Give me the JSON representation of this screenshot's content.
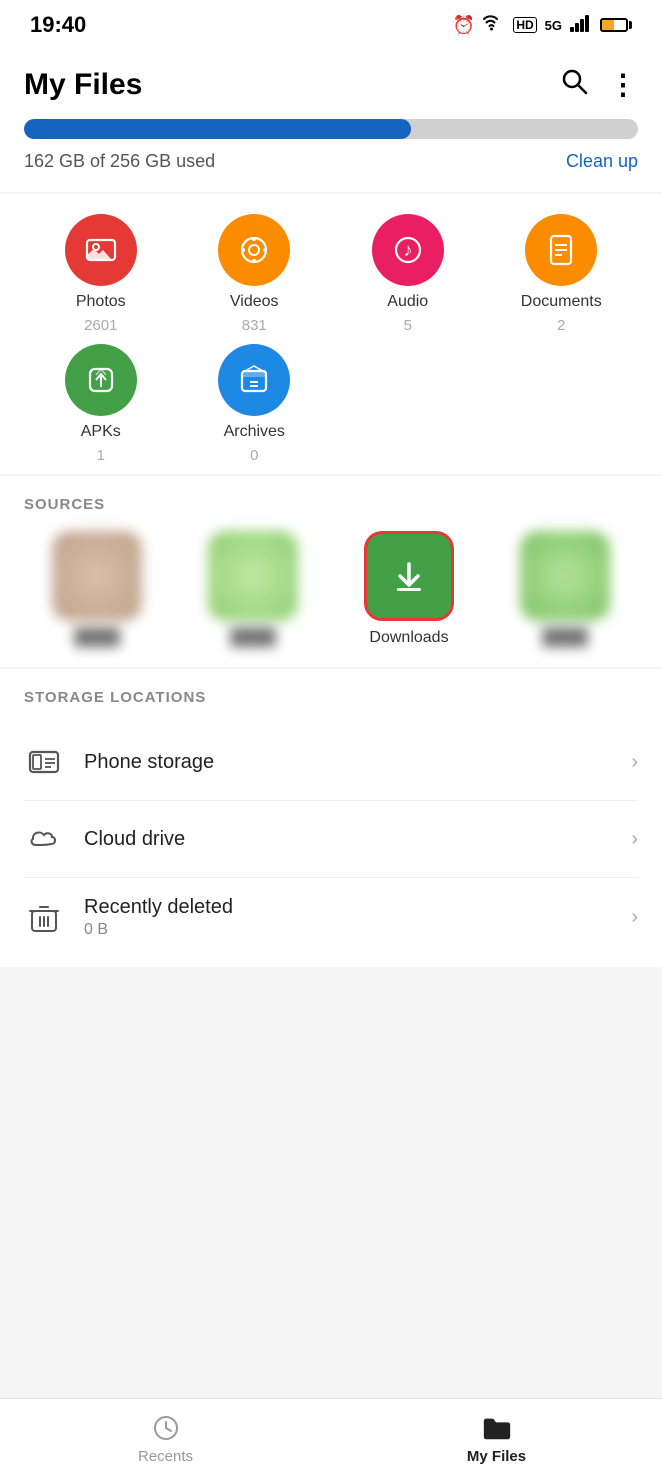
{
  "statusBar": {
    "time": "19:40",
    "batteryPercent": 50
  },
  "header": {
    "title": "My Files",
    "searchLabel": "search",
    "moreLabel": "more"
  },
  "storage": {
    "used": "162 GB of 256 GB used",
    "cleanupLabel": "Clean up",
    "fillPercent": 63
  },
  "categories": [
    {
      "id": "photos",
      "label": "Photos",
      "count": "2601",
      "color": "#e53935",
      "icon": "image"
    },
    {
      "id": "videos",
      "label": "Videos",
      "count": "831",
      "color": "#fb8c00",
      "icon": "video"
    },
    {
      "id": "audio",
      "label": "Audio",
      "count": "5",
      "color": "#e91e63",
      "icon": "music"
    },
    {
      "id": "documents",
      "label": "Documents",
      "count": "2",
      "color": "#fb8c00",
      "icon": "doc"
    },
    {
      "id": "apks",
      "label": "APKs",
      "count": "1",
      "color": "#43a047",
      "icon": "apk"
    },
    {
      "id": "archives",
      "label": "Archives",
      "count": "0",
      "color": "#1e88e5",
      "icon": "archive"
    }
  ],
  "sources": {
    "sectionTitle": "SOURCES",
    "items": [
      {
        "id": "source1",
        "label": "",
        "blurred": true
      },
      {
        "id": "source2",
        "label": "",
        "blurred": true
      },
      {
        "id": "downloads",
        "label": "Downloads",
        "blurred": false,
        "highlighted": true,
        "color": "#43a047"
      },
      {
        "id": "source4",
        "label": "",
        "blurred": true
      }
    ]
  },
  "storageLocations": {
    "sectionTitle": "STORAGE LOCATIONS",
    "items": [
      {
        "id": "phone",
        "label": "Phone storage",
        "sub": "",
        "icon": "hdd"
      },
      {
        "id": "cloud",
        "label": "Cloud drive",
        "sub": "",
        "icon": "cloud"
      },
      {
        "id": "deleted",
        "label": "Recently deleted",
        "sub": "0 B",
        "icon": "trash"
      }
    ]
  },
  "bottomNav": {
    "items": [
      {
        "id": "recents",
        "label": "Recents",
        "active": false,
        "icon": "clock"
      },
      {
        "id": "myfiles",
        "label": "My Files",
        "active": true,
        "icon": "folder"
      }
    ]
  }
}
